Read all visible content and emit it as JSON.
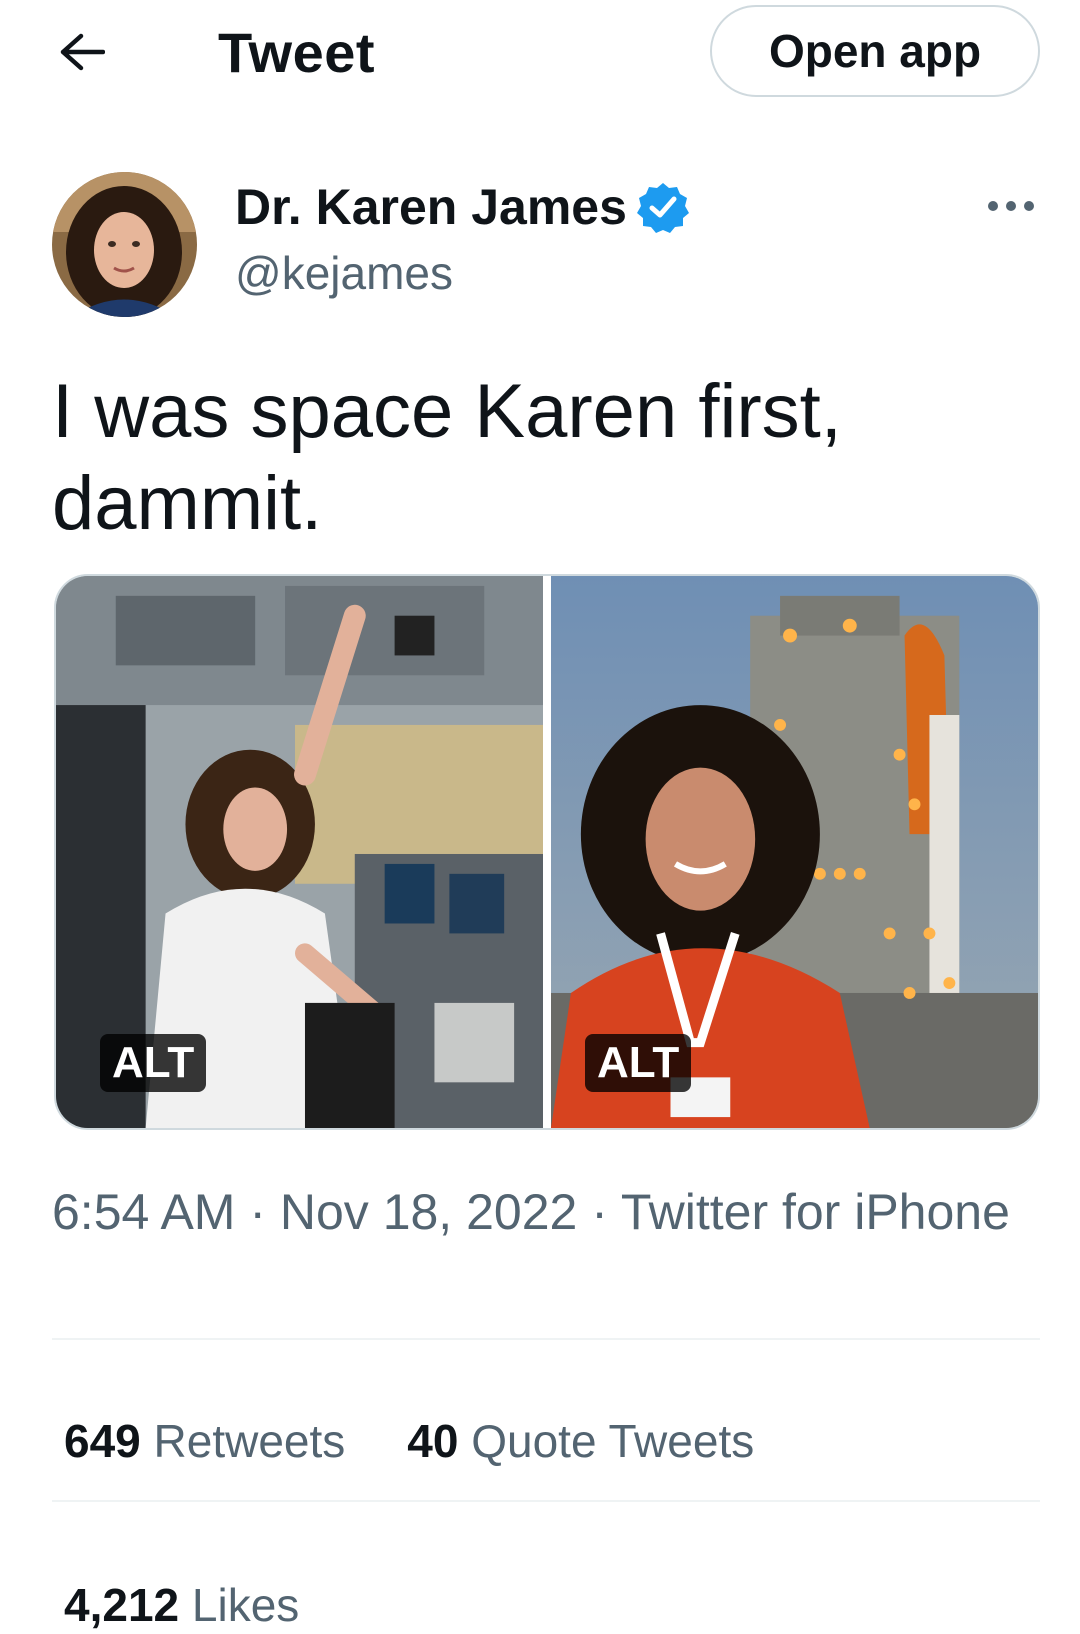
{
  "header": {
    "back_icon": "arrow-left-icon",
    "title": "Tweet",
    "open_app_label": "Open app"
  },
  "author": {
    "display_name": "Dr. Karen James",
    "verified_icon": "verified-badge-icon",
    "verified_color": "#1d9bf0",
    "handle": "@kejames"
  },
  "tweet": {
    "text": "I was space Karen first, dammit.",
    "media": [
      {
        "alt_label": "ALT"
      },
      {
        "alt_label": "ALT"
      }
    ],
    "timestamp": "6:54 AM · Nov 18, 2022 · Twitter for iPhone"
  },
  "stats": {
    "retweets_count": "649",
    "retweets_label": "Retweets",
    "quotes_count": "40",
    "quotes_label": "Quote Tweets",
    "likes_count": "4,212",
    "likes_label": "Likes"
  },
  "colors": {
    "text_primary": "#0f1419",
    "text_secondary": "#536471",
    "border": "#cfd9de"
  }
}
